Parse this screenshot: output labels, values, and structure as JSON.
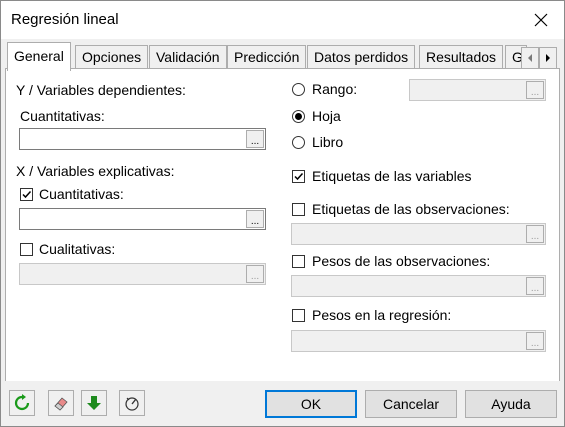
{
  "window": {
    "title": "Regresión lineal"
  },
  "tabs": [
    {
      "label": "General"
    },
    {
      "label": "Opciones"
    },
    {
      "label": "Validación"
    },
    {
      "label": "Predicción"
    },
    {
      "label": "Datos perdidos"
    },
    {
      "label": "Resultados"
    },
    {
      "label": "G"
    }
  ],
  "left": {
    "y_heading": "Y / Variables dependientes:",
    "y_quant_label": "Cuantitativas:",
    "y_quant_value": "",
    "x_heading": "X / Variables explicativas:",
    "x_quant_label": "Cuantitativas:",
    "x_quant_checked": true,
    "x_quant_value": "",
    "x_qual_label": "Cualitativas:",
    "x_qual_checked": false,
    "x_qual_value": ""
  },
  "right": {
    "range_label": "Rango:",
    "range_value": "",
    "sheet_label": "Hoja",
    "book_label": "Libro",
    "selected": "Hoja",
    "var_labels": "Etiquetas de las variables",
    "var_labels_checked": true,
    "obs_labels": "Etiquetas de las observaciones:",
    "obs_labels_checked": false,
    "obs_weights": "Pesos de las observaciones:",
    "obs_weights_checked": false,
    "reg_weights": "Pesos en la regresión:",
    "reg_weights_checked": false
  },
  "buttons": {
    "field_btn": "...",
    "ok": "OK",
    "cancel": "Cancelar",
    "help": "Ayuda"
  },
  "colors": {
    "accent": "#0078d7",
    "reset_icon": "#1a9a1a",
    "down_icon": "#1e8b1e"
  }
}
